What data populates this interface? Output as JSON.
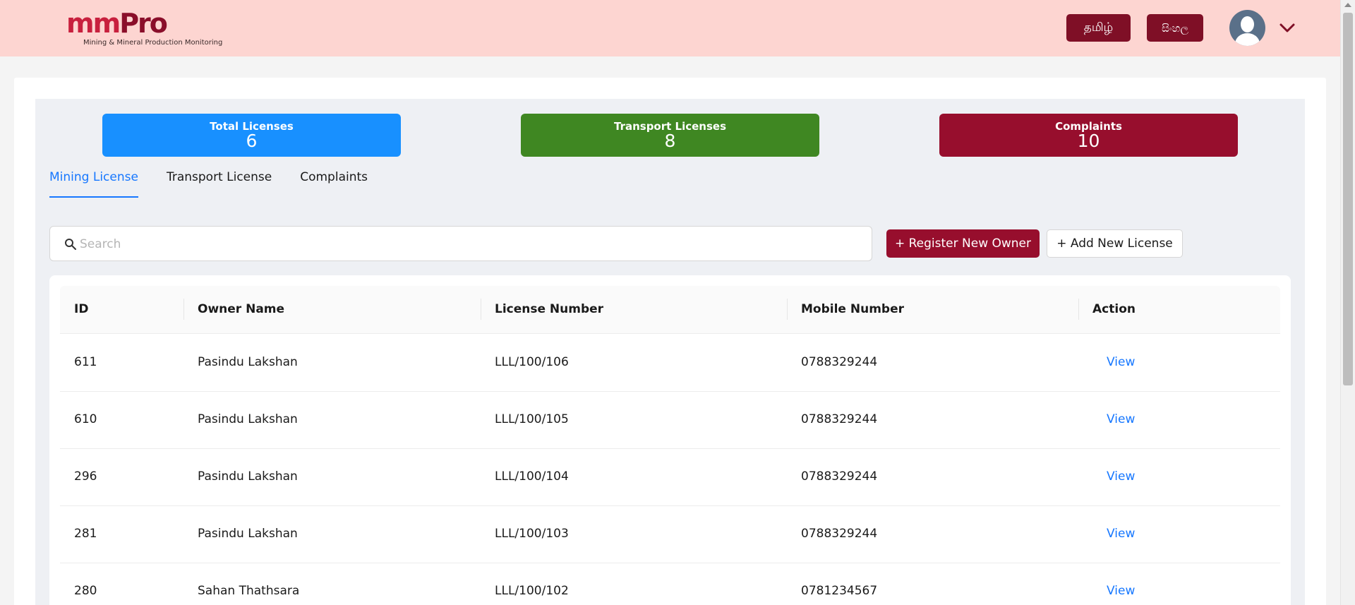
{
  "header": {
    "logo_mm": "mm",
    "logo_pro": "Pro",
    "logo_subtitle": "Mining & Mineral Production Monitoring",
    "lang_tamil": "தமிழ்",
    "lang_sinhala": "සිංහල",
    "avatar_icon": "user-avatar-icon",
    "menu_icon": "chevron-down-icon"
  },
  "stats": {
    "total": {
      "label": "Total Licenses",
      "value": "6",
      "color": "#1890ff"
    },
    "transport": {
      "label": "Transport Licenses",
      "value": "8",
      "color": "#3f8722"
    },
    "complaints": {
      "label": "Complaints",
      "value": "10",
      "color": "#970e2d"
    }
  },
  "tabs": [
    {
      "label": "Mining License",
      "active": true
    },
    {
      "label": "Transport License",
      "active": false
    },
    {
      "label": "Complaints",
      "active": false
    }
  ],
  "search": {
    "placeholder": "Search",
    "value": ""
  },
  "actions": {
    "register_label": "+ Register New Owner",
    "add_label": "+ Add New License"
  },
  "table": {
    "columns": [
      "ID",
      "Owner Name",
      "License Number",
      "Mobile Number",
      "Action"
    ],
    "rows": [
      {
        "id": "611",
        "owner": "Pasindu Lakshan",
        "license": "LLL/100/106",
        "mobile": "0788329244",
        "action": "View"
      },
      {
        "id": "610",
        "owner": "Pasindu Lakshan",
        "license": "LLL/100/105",
        "mobile": "0788329244",
        "action": "View"
      },
      {
        "id": "296",
        "owner": "Pasindu Lakshan",
        "license": "LLL/100/104",
        "mobile": "0788329244",
        "action": "View"
      },
      {
        "id": "281",
        "owner": "Pasindu Lakshan",
        "license": "LLL/100/103",
        "mobile": "0788329244",
        "action": "View"
      },
      {
        "id": "280",
        "owner": "Sahan Thathsara",
        "license": "LLL/100/102",
        "mobile": "0781234567",
        "action": "View"
      }
    ]
  },
  "colors": {
    "header_bg": "#fdd5d1",
    "brand_primary": "#970e2d",
    "link_blue": "#1677ff"
  }
}
